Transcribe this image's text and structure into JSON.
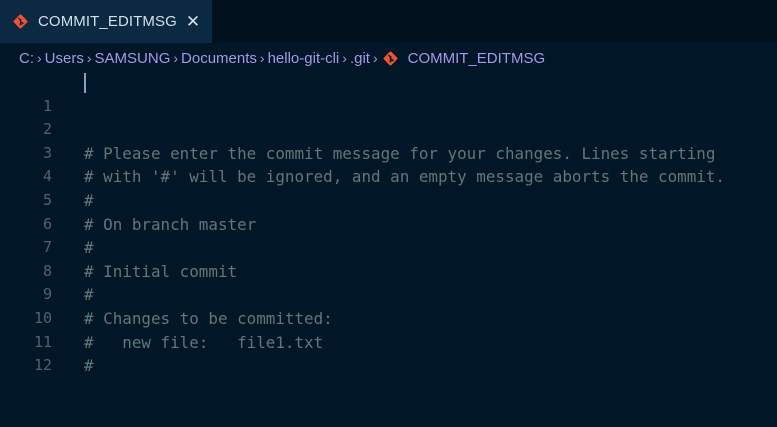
{
  "tab": {
    "title": "COMMIT_EDITMSG",
    "close_symbol": "✕",
    "icon": "git-icon"
  },
  "breadcrumb": {
    "items": [
      "C:",
      "Users",
      "SAMSUNG",
      "Documents",
      "hello-git-cli",
      ".git",
      "COMMIT_EDITMSG"
    ],
    "separator": "›"
  },
  "editor": {
    "lines": [
      {
        "number": "1",
        "text": ""
      },
      {
        "number": "2",
        "text": "# Please enter the commit message for your changes. Lines starting"
      },
      {
        "number": "3",
        "text": "# with '#' will be ignored, and an empty message aborts the commit."
      },
      {
        "number": "4",
        "text": "#"
      },
      {
        "number": "5",
        "text": "# On branch master"
      },
      {
        "number": "6",
        "text": "#"
      },
      {
        "number": "7",
        "text": "# Initial commit"
      },
      {
        "number": "8",
        "text": "#"
      },
      {
        "number": "9",
        "text": "# Changes to be committed:"
      },
      {
        "number": "10",
        "text": "#   new file:   file1.txt"
      },
      {
        "number": "11",
        "text": "#"
      },
      {
        "number": "12",
        "text": ""
      }
    ]
  },
  "colors": {
    "background": "#011627",
    "tab_background": "#0b2942",
    "breadcrumb_text": "#a599e9",
    "comment_text": "#637777",
    "line_number": "#4b6479",
    "git_icon": "#f05133"
  }
}
